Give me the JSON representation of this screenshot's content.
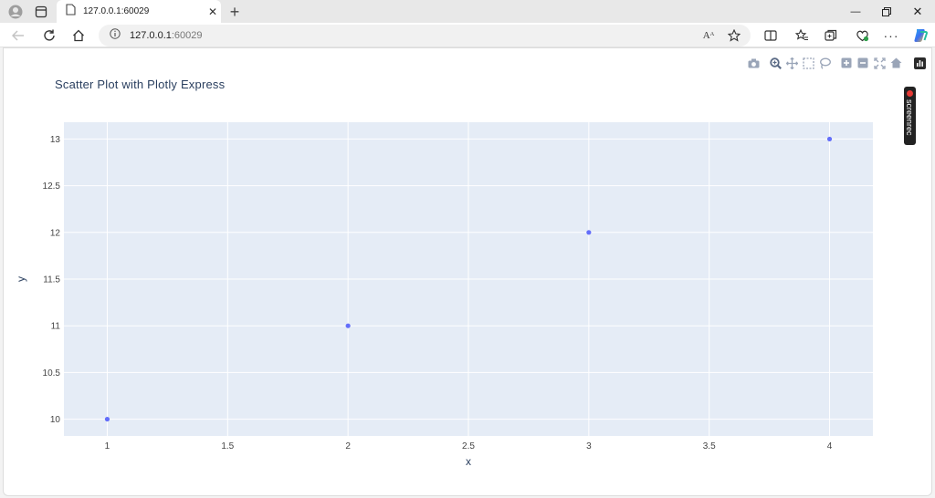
{
  "browser": {
    "tab_title": "127.0.0.1:60029",
    "address_host": "127.0.0.1",
    "address_port": ":60029",
    "read_aloud_glyph": "Aᴬ"
  },
  "extension": {
    "name": "screenrec"
  },
  "chart_data": {
    "type": "scatter",
    "title": "Scatter Plot with Plotly Express",
    "xlabel": "x",
    "ylabel": "y",
    "x": [
      1,
      2,
      3,
      4
    ],
    "y": [
      10,
      11,
      12,
      13
    ],
    "xlim": [
      0.82,
      4.18
    ],
    "ylim": [
      9.82,
      13.18
    ],
    "x_ticks": [
      1,
      1.5,
      2,
      2.5,
      3,
      3.5,
      4
    ],
    "y_ticks": [
      10,
      10.5,
      11,
      11.5,
      12,
      12.5,
      13
    ],
    "x_tick_labels": [
      "1",
      "1.5",
      "2",
      "2.5",
      "3",
      "3.5",
      "4"
    ],
    "y_tick_labels": [
      "10",
      "10.5",
      "11",
      "11.5",
      "12",
      "12.5",
      "13"
    ],
    "grid": true,
    "marker_color": "#636efa",
    "plot_bgcolor": "#e5ecf6"
  },
  "colors": {
    "title": "#2a3f5f",
    "tick": "#444444",
    "grid": "#ffffff"
  }
}
